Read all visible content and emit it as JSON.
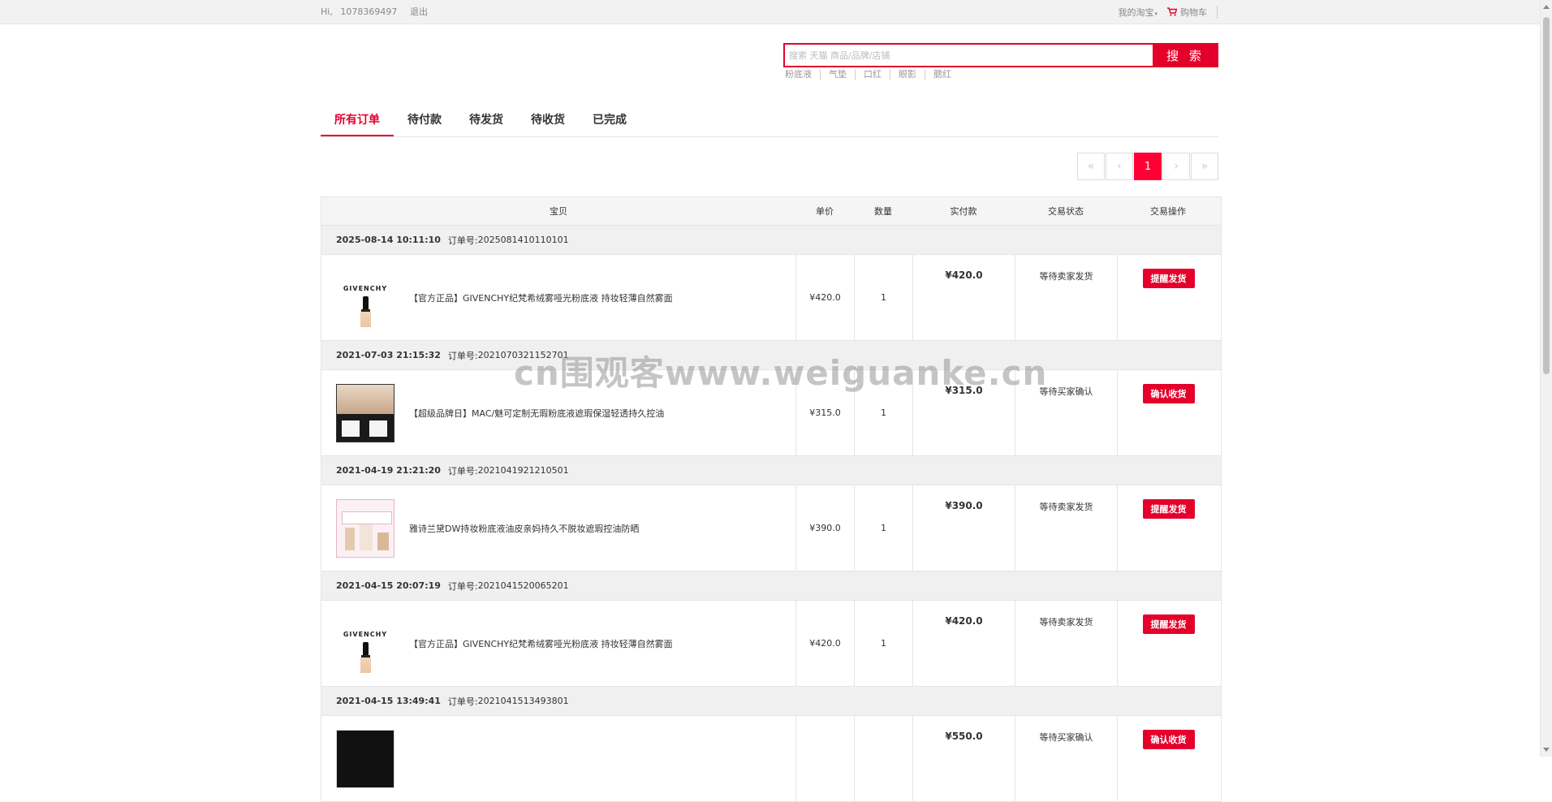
{
  "topbar": {
    "greeting": "Hi,",
    "username": "1078369497",
    "logout": "退出",
    "my_taobao": "我的淘宝",
    "my_taobao_arrow": "▾",
    "cart": "购物车"
  },
  "search": {
    "placeholder": "搜索 天猫 商品/品牌/店铺",
    "button": "搜 索",
    "hot": [
      "粉底液",
      "气垫",
      "口红",
      "眼影",
      "腮红"
    ]
  },
  "tabs": [
    "所有订单",
    "待付款",
    "待发货",
    "待收货",
    "已完成"
  ],
  "active_tab": "所有订单",
  "pager": {
    "first": "«",
    "prev": "‹",
    "current": "1",
    "next": "›",
    "last": "»"
  },
  "columns": [
    "宝贝",
    "单价",
    "数量",
    "实付款",
    "交易状态",
    "交易操作"
  ],
  "order_label": "订单号:",
  "orders": [
    {
      "date": "2025-08-14 10:11:10",
      "order_no": "2025081410110101",
      "brand": "GIVENCHY",
      "title": "【官方正品】GIVENCHY纪梵希绒雾哑光粉底液 持妆轻薄自然雾面",
      "price": "¥420.0",
      "qty": "1",
      "paid": "¥420.0",
      "status": "等待卖家发货",
      "action": "提醒发货"
    },
    {
      "date": "2021-07-03 21:15:32",
      "order_no": "2021070321152701",
      "brand": "",
      "title": "【超级品牌日】MAC/魅可定制无瑕粉底液遮瑕保湿轻透持久控油",
      "price": "¥315.0",
      "qty": "1",
      "paid": "¥315.0",
      "status": "等待买家确认",
      "action": "确认收货"
    },
    {
      "date": "2021-04-19 21:21:20",
      "order_no": "2021041921210501",
      "brand": "",
      "title": "雅诗兰黛DW持妆粉底液油皮亲妈持久不脱妆遮瑕控油防晒",
      "price": "¥390.0",
      "qty": "1",
      "paid": "¥390.0",
      "status": "等待卖家发货",
      "action": "提醒发货"
    },
    {
      "date": "2021-04-15 20:07:19",
      "order_no": "2021041520065201",
      "brand": "GIVENCHY",
      "title": "【官方正品】GIVENCHY纪梵希绒雾哑光粉底液 持妆轻薄自然雾面",
      "price": "¥420.0",
      "qty": "1",
      "paid": "¥420.0",
      "status": "等待卖家发货",
      "action": "提醒发货"
    },
    {
      "date": "2021-04-15 13:49:41",
      "order_no": "2021041513493801",
      "brand": "",
      "title": "",
      "price": "",
      "qty": "",
      "paid": "¥550.0",
      "status": "等待买家确认",
      "action": "确认收货"
    }
  ],
  "watermark": "cn围观客www.weiguanke.cn",
  "colors": {
    "accent": "#e4002b",
    "pager_active": "#ff0036"
  }
}
